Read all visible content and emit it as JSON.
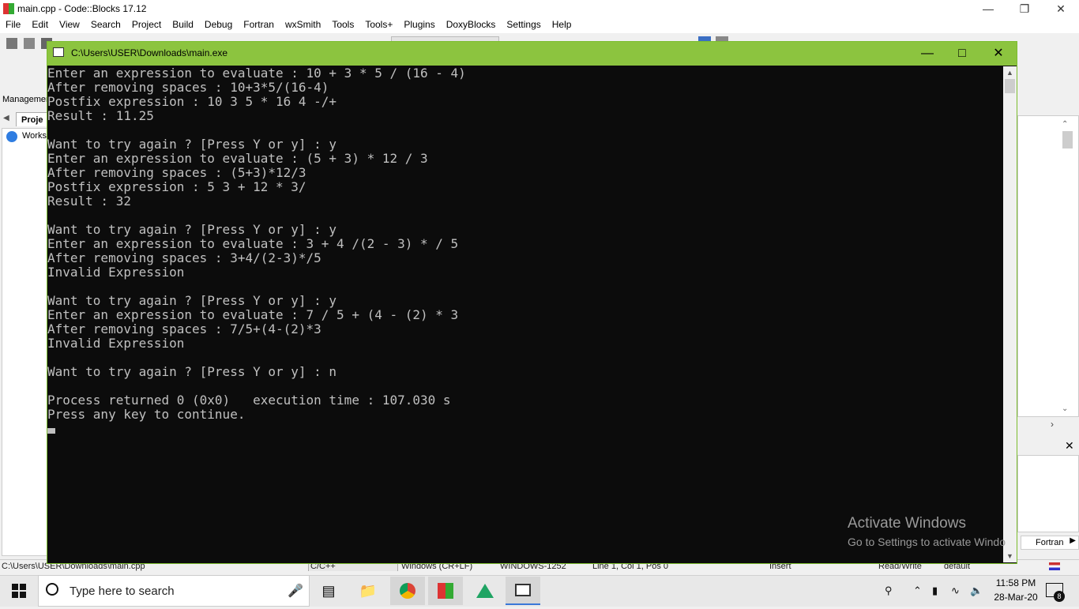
{
  "ide": {
    "title": "main.cpp - Code::Blocks 17.12",
    "menu": [
      "File",
      "Edit",
      "View",
      "Search",
      "Project",
      "Build",
      "Debug",
      "Fortran",
      "wxSmith",
      "Tools",
      "Tools+",
      "Plugins",
      "DoxyBlocks",
      "Settings",
      "Help"
    ],
    "management_label": "Managemen",
    "projects_tab": "Proje",
    "workspace_item": "Works",
    "fortran_tab": "Fortran",
    "statusbar": {
      "path": "C:\\Users\\USER\\Downloads\\main.cpp",
      "language": "C/C++",
      "eol": "Windows (CR+LF)",
      "encoding": "WINDOWS-1252",
      "position": "Line 1, Col 1, Pos 0",
      "mode": "Insert",
      "access": "Read/Write",
      "profile": "default"
    }
  },
  "console": {
    "title": "C:\\Users\\USER\\Downloads\\main.exe",
    "lines": [
      "Enter an expression to evaluate : 10 + 3 * 5 / (16 - 4)",
      "After removing spaces : 10+3*5/(16-4)",
      "Postfix expression : 10 3 5 * 16 4 -/+",
      "Result : 11.25",
      "",
      "Want to try again ? [Press Y or y] : y",
      "Enter an expression to evaluate : (5 + 3) * 12 / 3",
      "After removing spaces : (5+3)*12/3",
      "Postfix expression : 5 3 + 12 * 3/",
      "Result : 32",
      "",
      "Want to try again ? [Press Y or y] : y",
      "Enter an expression to evaluate : 3 + 4 /(2 - 3) * / 5",
      "After removing spaces : 3+4/(2-3)*/5",
      "Invalid Expression",
      "",
      "Want to try again ? [Press Y or y] : y",
      "Enter an expression to evaluate : 7 / 5 + (4 - (2) * 3",
      "After removing spaces : 7/5+(4-(2)*3",
      "Invalid Expression",
      "",
      "Want to try again ? [Press Y or y] : n",
      "",
      "Process returned 0 (0x0)   execution time : 107.030 s",
      "Press any key to continue."
    ]
  },
  "watermark": {
    "line1": "Activate Windows",
    "line2": "Go to Settings to activate Windo"
  },
  "taskbar": {
    "search_placeholder": "Type here to search",
    "time": "11:58 PM",
    "date": "28-Mar-20",
    "notification_count": "8"
  }
}
